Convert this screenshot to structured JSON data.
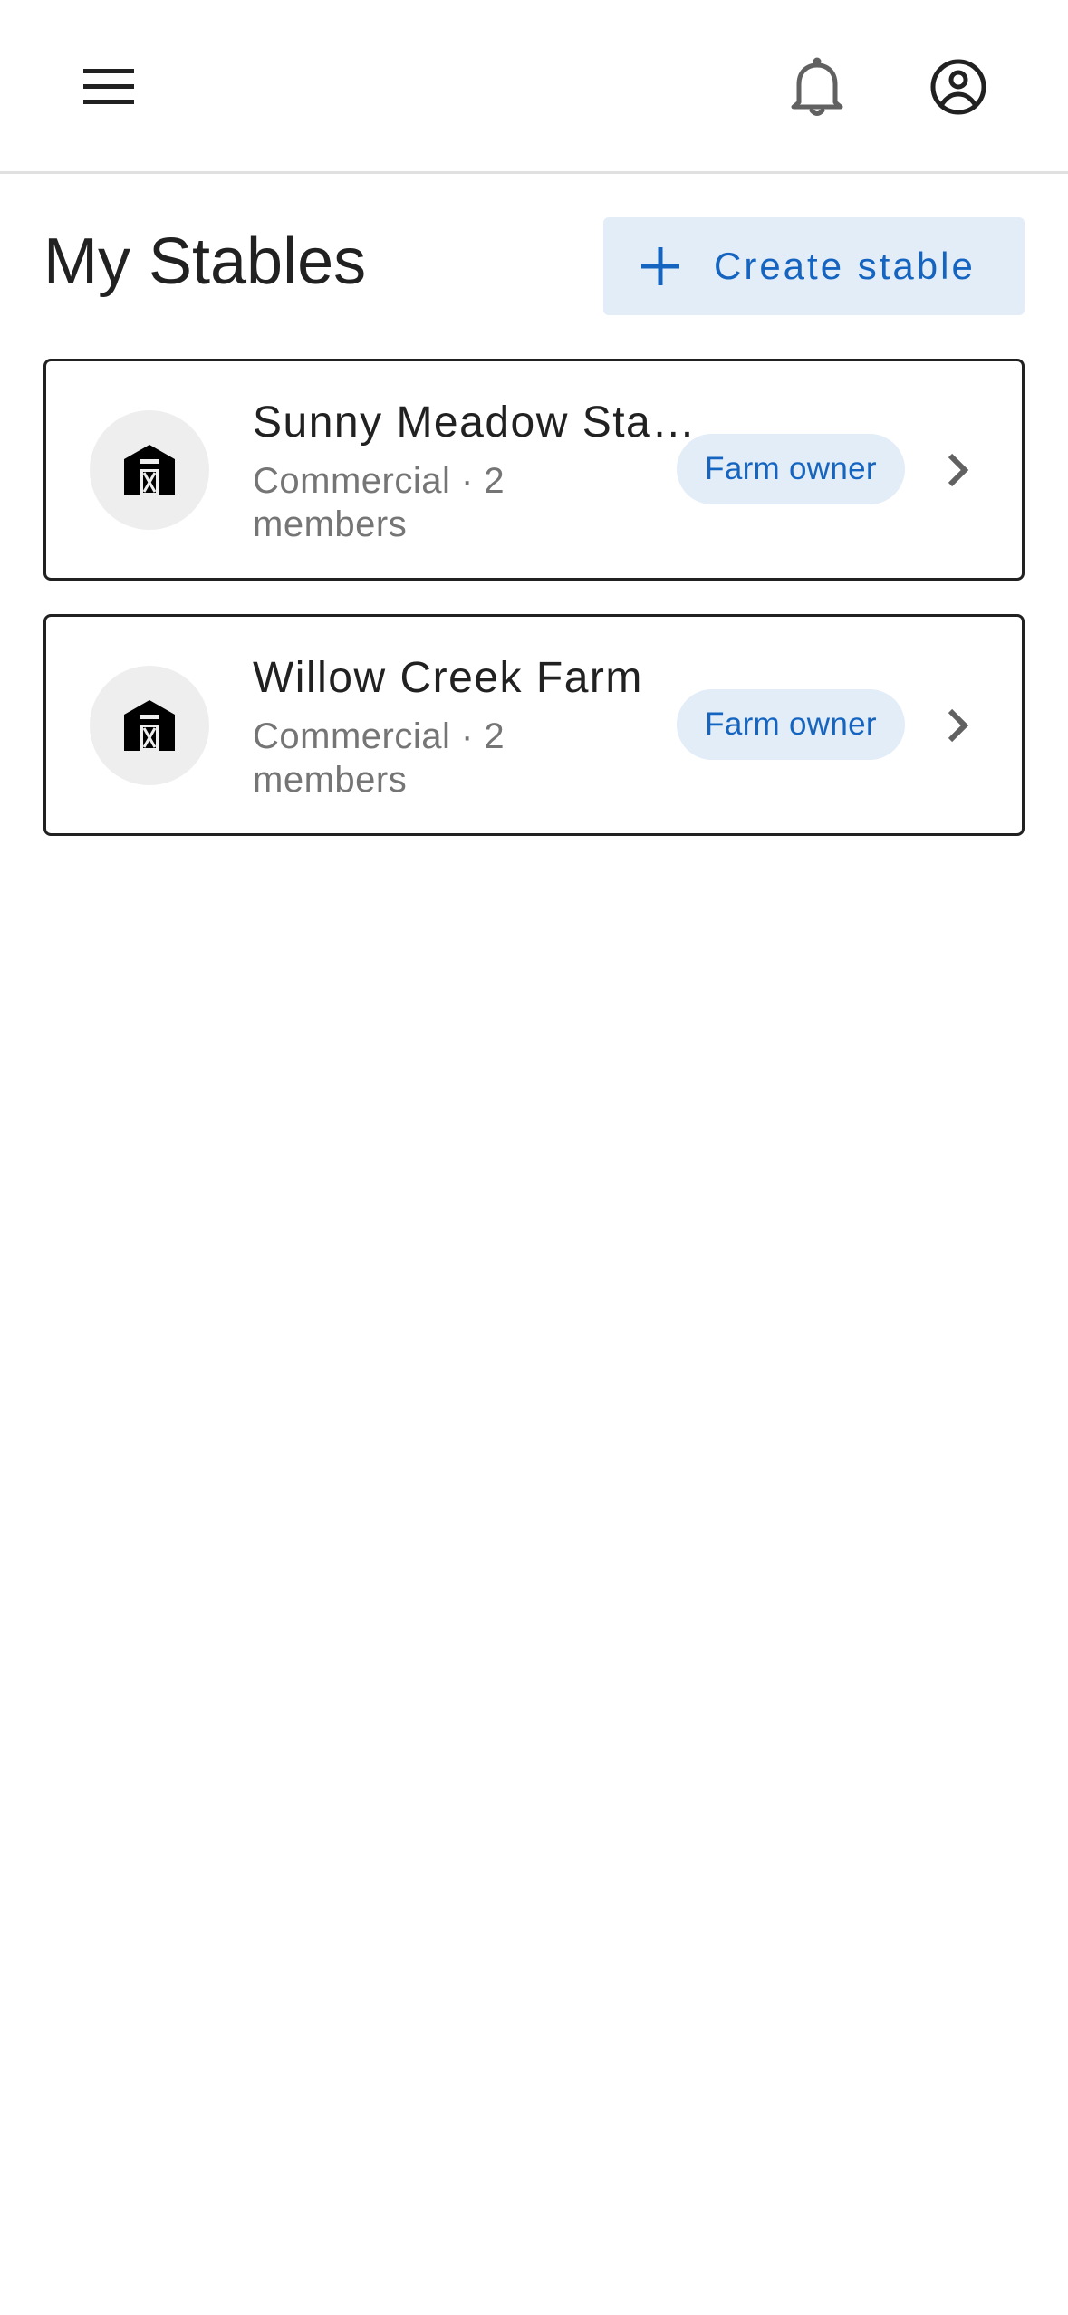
{
  "header": {
    "menu_icon": "menu-icon",
    "notifications_icon": "bell-icon",
    "account_icon": "account-circle-icon"
  },
  "page": {
    "title": "My Stables",
    "create_button_label": "Create stable",
    "create_button_icon": "plus-icon"
  },
  "stables": [
    {
      "name": "Sunny Meadow Stables",
      "meta": "Commercial · 2 members",
      "role": "Farm owner",
      "icon": "barn-icon"
    },
    {
      "name": "Willow Creek Farm",
      "meta": "Commercial · 2 members",
      "role": "Farm owner",
      "icon": "barn-icon"
    }
  ],
  "colors": {
    "accent": "#1565c0",
    "accent_light": "#e3edf8",
    "text_primary": "#212121",
    "text_secondary": "#757575",
    "avatar_bg": "#eeeeee"
  }
}
